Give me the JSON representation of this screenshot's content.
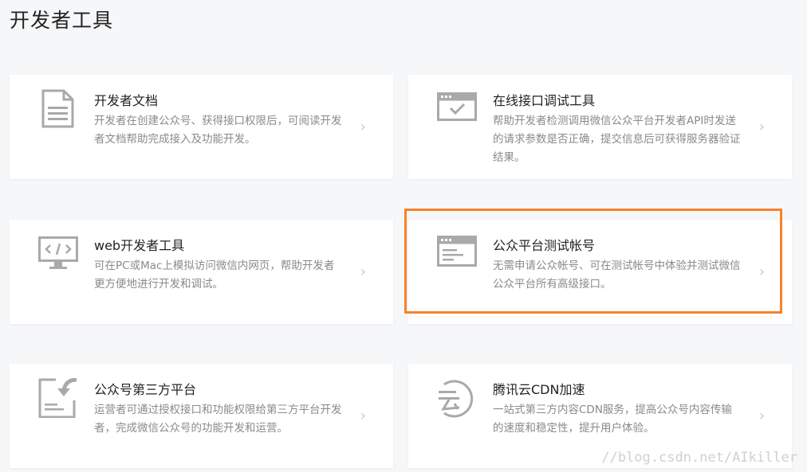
{
  "page": {
    "title": "开发者工具"
  },
  "cards": [
    {
      "title": "开发者文档",
      "desc": "开发者在创建公众号、获得接口权限后，可阅读开发者文档帮助完成接入及功能开发。",
      "icon": "document-icon"
    },
    {
      "title": "在线接口调试工具",
      "desc": "帮助开发者检测调用微信公众平台开发者API时发送的请求参数是否正确，提交信息后可获得服务器验证结果。",
      "icon": "browser-check-icon"
    },
    {
      "title": "web开发者工具",
      "desc": "可在PC或Mac上模拟访问微信内网页，帮助开发者更方便地进行开发和调试。",
      "icon": "monitor-code-icon"
    },
    {
      "title": "公众平台测试帐号",
      "desc": "无需申请公众帐号、可在测试帐号中体验并测试微信公众平台所有高级接口。",
      "icon": "browser-window-icon"
    },
    {
      "title": "公众号第三方平台",
      "desc": "运营者可通过授权接口和功能权限给第三方平台开发者，完成微信公众号的功能开发和运营。",
      "icon": "authorize-icon"
    },
    {
      "title": "腾讯云CDN加速",
      "desc": "一站式第三方内容CDN服务，提高公众号内容传输的速度和稳定性，提升用户体验。",
      "icon": "tencent-cloud-icon"
    }
  ],
  "chevron": "›",
  "watermark": "//blog.csdn.net/AIkiller",
  "colors": {
    "highlight": "#f5832b",
    "icon": "#a9a9a9",
    "background": "#f6f7f8"
  }
}
